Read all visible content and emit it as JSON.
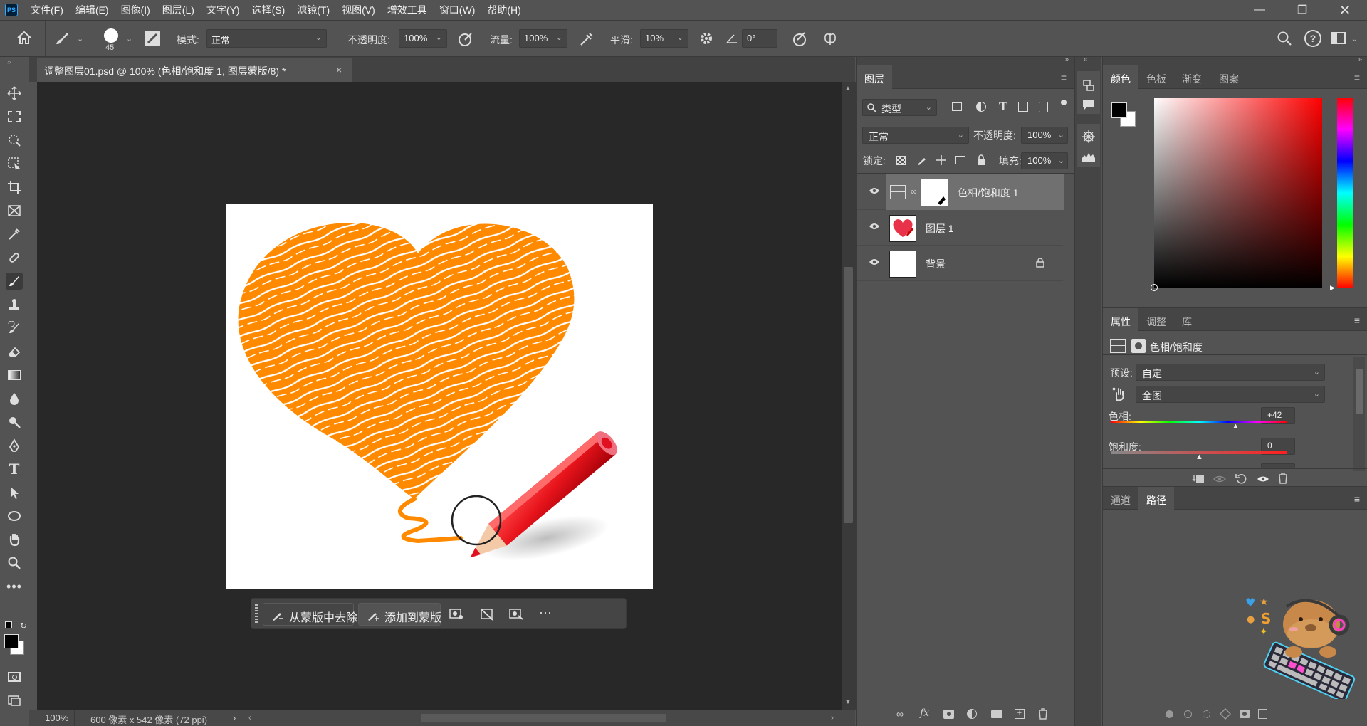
{
  "menubar": {
    "app_icon": "PS",
    "items": [
      "文件(F)",
      "编辑(E)",
      "图像(I)",
      "图层(L)",
      "文字(Y)",
      "选择(S)",
      "滤镜(T)",
      "视图(V)",
      "增效工具",
      "窗口(W)",
      "帮助(H)"
    ]
  },
  "options": {
    "brush_size": "45",
    "mode_label": "模式:",
    "mode_value": "正常",
    "opacity_label": "不透明度:",
    "opacity_value": "100%",
    "flow_label": "流量:",
    "flow_value": "100%",
    "smooth_label": "平滑:",
    "smooth_value": "10%",
    "angle_value": "0°"
  },
  "document": {
    "tab_title": "调整图层01.psd @ 100% (色相/饱和度 1, 图层蒙版/8) *",
    "zoom": "100%",
    "size_info": "600 像素 x 542 像素 (72 ppi)"
  },
  "context_bar": {
    "subtract_label": "从蒙版中去除",
    "add_label": "添加到蒙版"
  },
  "layers_panel": {
    "tab": "图层",
    "filter_label": "类型",
    "blend_mode": "正常",
    "opacity_label": "不透明度:",
    "opacity_value": "100%",
    "lock_label": "锁定:",
    "fill_label": "填充:",
    "fill_value": "100%",
    "layers": [
      {
        "name": "色相/饱和度 1"
      },
      {
        "name": "图层 1"
      },
      {
        "name": "背景"
      }
    ]
  },
  "color_panel": {
    "tabs": [
      "颜色",
      "色板",
      "渐变",
      "图案"
    ],
    "fg_color": "#000000",
    "bg_color": "#ffffff",
    "hue_color": "#ff0000"
  },
  "properties_panel": {
    "tabs": [
      "属性",
      "调整",
      "库"
    ],
    "title": "色相/饱和度",
    "preset_label": "预设:",
    "preset_value": "自定",
    "channel_value": "全图",
    "hue_label": "色相:",
    "hue_value": "+42",
    "saturation_label": "饱和度:",
    "saturation_value": "0"
  },
  "paths_panel": {
    "tabs": [
      "通道",
      "路径"
    ]
  }
}
